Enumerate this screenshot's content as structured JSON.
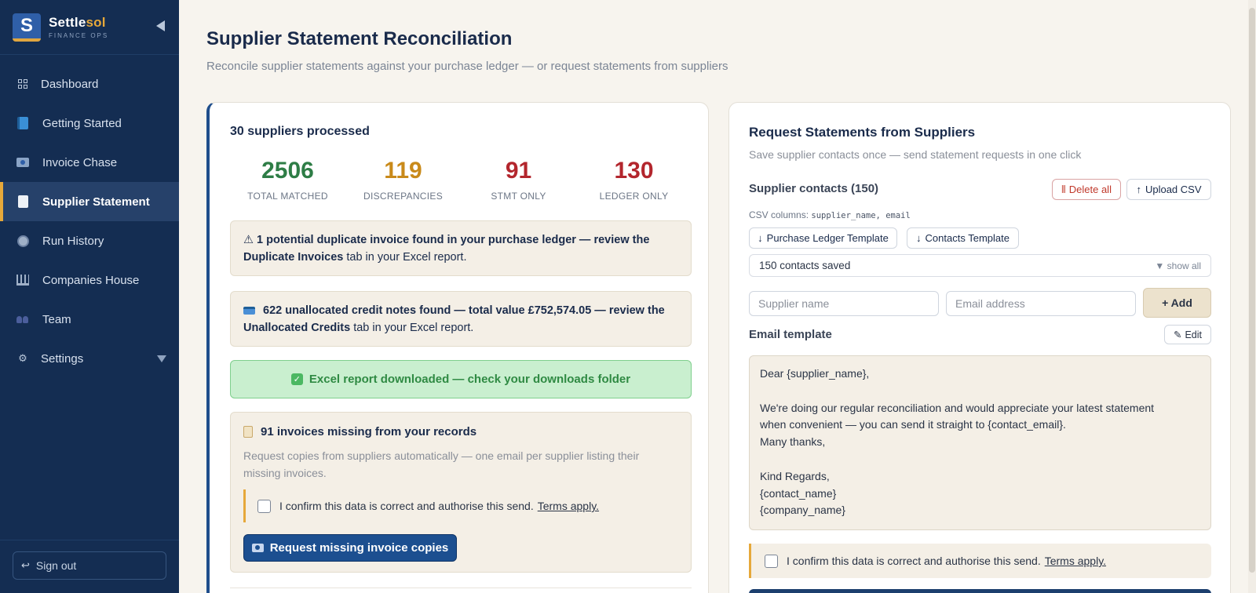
{
  "sidebar": {
    "brand_name_main": "Settle",
    "brand_name_accent": "sol",
    "brand_sub": "FINANCE OPS",
    "logo_letter": "S",
    "items": [
      {
        "label": "Dashboard",
        "icon": "grid-icon"
      },
      {
        "label": "Getting Started",
        "icon": "book-icon"
      },
      {
        "label": "Invoice Chase",
        "icon": "mail-icon"
      },
      {
        "label": "Supplier Statement",
        "icon": "document-icon",
        "active": true
      },
      {
        "label": "Run History",
        "icon": "clock-icon"
      },
      {
        "label": "Companies House",
        "icon": "bank-icon"
      },
      {
        "label": "Team",
        "icon": "team-icon"
      },
      {
        "label": "Settings",
        "icon": "gear-icon"
      }
    ],
    "sign_out": "Sign out"
  },
  "page": {
    "title": "Supplier Statement Reconciliation",
    "subtitle": "Reconcile supplier statements against your purchase ledger — or request statements from suppliers"
  },
  "results": {
    "title": "30 suppliers processed",
    "stats": [
      {
        "value": "2506",
        "label": "TOTAL MATCHED",
        "color": "#2e7d46"
      },
      {
        "value": "119",
        "label": "DISCREPANCIES",
        "color": "#c98a1a"
      },
      {
        "value": "91",
        "label": "STMT ONLY",
        "color": "#b3262d"
      },
      {
        "value": "130",
        "label": "LEDGER ONLY",
        "color": "#b3262d"
      }
    ],
    "duplicate_notice": {
      "icon": "⚠",
      "text1": "1 potential duplicate invoice found in your purchase ledger — review the",
      "bold2": "Duplicate Invoices",
      "text2": "tab in your Excel report."
    },
    "credit_notice": {
      "text1": "622 unallocated credit notes found — total value £752,574.05 — review the",
      "bold2": "Unallocated Credits",
      "text2": "tab in your Excel report."
    },
    "download_notice": "Excel report downloaded — check your downloads folder",
    "missing": {
      "title": "91 invoices missing from your records",
      "description": "Request copies from suppliers automatically — one email per supplier listing their missing invoices.",
      "confirm_text": "I confirm this data is correct and authorise this send.",
      "terms": "Terms apply.",
      "button": "Request missing invoice copies"
    }
  },
  "request": {
    "title": "Request Statements from Suppliers",
    "subtitle": "Save supplier contacts once — send statement requests in one click",
    "contacts_label": "Supplier contacts (150)",
    "delete_all": "Delete all",
    "upload_csv": "Upload CSV",
    "csv_columns_label": "CSV columns:",
    "csv_columns": "supplier_name, email",
    "purchase_template": "Purchase Ledger Template",
    "contacts_template": "Contacts Template",
    "saved_count": "150 contacts saved",
    "show_all": "show all",
    "supplier_placeholder": "Supplier name",
    "email_placeholder": "Email address",
    "add_button": "+ Add",
    "email_template_label": "Email template",
    "edit_button": "Edit",
    "template_lines": [
      "Dear {supplier_name},",
      "",
      "We're doing our regular reconciliation and would appreciate your latest statement",
      "when convenient — you can send it straight to {contact_email}.",
      "Many thanks,",
      "",
      "Kind Regards,",
      "{contact_name}",
      "{company_name}"
    ],
    "confirm_text": "I confirm this data is correct and authorise this send.",
    "terms": "Terms apply."
  }
}
